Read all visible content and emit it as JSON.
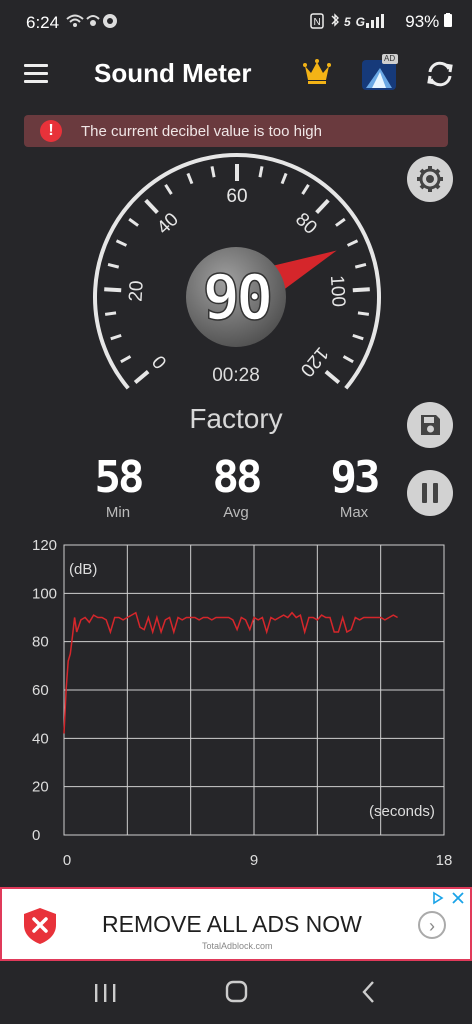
{
  "status_bar": {
    "time": "6:24",
    "left_icons": "wifi-call signal whatsapp",
    "right_icons": "nfc bluetooth 5G signal",
    "battery": "93%"
  },
  "app_bar": {
    "title": "Sound Meter",
    "ad_badge": "AD"
  },
  "alert": {
    "text": "The current decibel value is too high",
    "icon": "!"
  },
  "gauge": {
    "min": 0,
    "max": 120,
    "tick_labels": [
      "0",
      "20",
      "40",
      "60",
      "80",
      "100",
      "120"
    ],
    "current_value": "90",
    "elapsed": "00:28",
    "needle_color": "#d5262b"
  },
  "environment": {
    "label": "Factory"
  },
  "stats": {
    "min": {
      "value": "58",
      "label": "Min"
    },
    "avg": {
      "value": "88",
      "label": "Avg"
    },
    "max": {
      "value": "93",
      "label": "Max"
    }
  },
  "chart_data": {
    "type": "line",
    "ylabel": "(dB)",
    "xlabel": "(seconds)",
    "ylim": [
      0,
      120
    ],
    "xlim": [
      0,
      18
    ],
    "y_ticks": [
      "0",
      "20",
      "40",
      "60",
      "80",
      "100",
      "120"
    ],
    "x_ticks": [
      "0",
      "9",
      "18"
    ],
    "series": [
      {
        "color": "#d5262b",
        "x": [
          0,
          0.1,
          0.2,
          0.3,
          0.4,
          0.5,
          0.6,
          0.8,
          1.0,
          1.2,
          1.4,
          1.6,
          1.8,
          2.0,
          2.2,
          2.4,
          2.6,
          2.8,
          3.0,
          3.2,
          3.4,
          3.6,
          3.8,
          4.0,
          4.2,
          4.4,
          4.6,
          4.8,
          5.0,
          5.2,
          5.4,
          5.6,
          5.8,
          6.0,
          6.2,
          6.4,
          6.6,
          6.8,
          7.0,
          7.2,
          7.4,
          7.6,
          7.8,
          8.0,
          8.2,
          8.4,
          8.6,
          8.8,
          9.0,
          9.2,
          9.4,
          9.6,
          9.8,
          10.0,
          10.2,
          10.4,
          10.6,
          10.8,
          11.0,
          11.2,
          11.4,
          11.6,
          11.8,
          12.0,
          12.2,
          12.4,
          12.6,
          12.8,
          13.0,
          13.2,
          13.4,
          13.6,
          13.8,
          14.0,
          14.2,
          14.4,
          14.6,
          14.8,
          15.0,
          15.2,
          15.4,
          15.6,
          15.8
        ],
        "values": [
          42,
          60,
          72,
          75,
          82,
          90,
          84,
          89,
          90,
          88,
          91,
          90,
          90,
          89,
          84,
          90,
          90,
          89,
          90,
          91,
          92,
          86,
          85,
          90,
          84,
          90,
          84,
          89,
          90,
          84,
          90,
          89,
          90,
          90,
          90,
          89,
          90,
          90,
          89,
          90,
          90,
          90,
          90,
          89,
          85,
          90,
          89,
          85,
          90,
          89,
          90,
          84,
          90,
          89,
          90,
          91,
          90,
          92,
          90,
          91,
          84,
          90,
          90,
          89,
          91,
          90,
          90,
          84,
          84,
          90,
          84,
          85,
          90,
          89,
          90,
          90,
          90,
          90,
          90,
          89,
          90,
          91,
          90
        ]
      }
    ]
  },
  "ad": {
    "headline": "REMOVE ALL ADS NOW",
    "subtext": "TotalAdblock.com"
  },
  "nav_bar": {
    "recent": "|||",
    "home": "○",
    "back": "<"
  }
}
